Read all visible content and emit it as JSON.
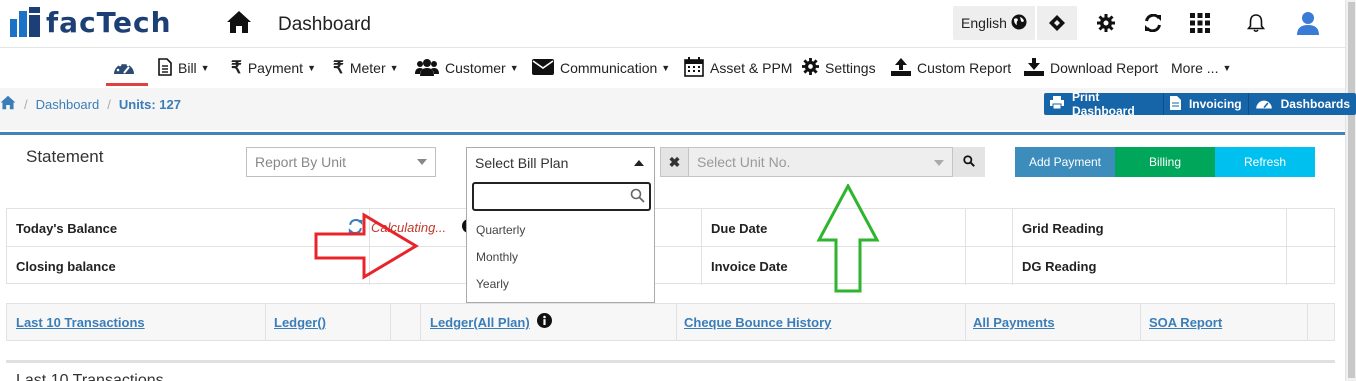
{
  "header": {
    "brand": "facTech",
    "page_title": "Dashboard",
    "language": "English"
  },
  "nav": {
    "items": [
      {
        "label": "Bill"
      },
      {
        "label": "Payment"
      },
      {
        "label": "Meter"
      },
      {
        "label": "Customer"
      },
      {
        "label": "Communication"
      },
      {
        "label": "Asset & PPM"
      },
      {
        "label": "Settings"
      },
      {
        "label": "Custom Report"
      },
      {
        "label": "Download Report"
      },
      {
        "label": "More ..."
      }
    ]
  },
  "breadcrumb": {
    "link": "Dashboard",
    "units": "Units: 127"
  },
  "toolbar": {
    "print": "Print Dashboard",
    "invoicing": "Invoicing",
    "dashboards": "Dashboards"
  },
  "statement": {
    "title": "Statement",
    "report_select": "Report By Unit",
    "bill_plan_select": "Select Bill Plan",
    "bill_plan_options": [
      "Quarterly",
      "Monthly",
      "Yearly"
    ],
    "unit_placeholder": "Select Unit No.",
    "buttons": {
      "add_payment": "Add Payment",
      "billing": "Billing",
      "refresh": "Refresh"
    }
  },
  "balance": {
    "todays_balance": "Today's Balance",
    "calculating": "Calculating...",
    "closing_balance": "Closing balance",
    "due_date": "Due Date",
    "invoice_date": "Invoice Date",
    "grid_reading": "Grid Reading",
    "dg_reading": "DG Reading"
  },
  "links": {
    "last10": "Last 10 Transactions",
    "ledger": "Ledger()",
    "ledger_all": "Ledger(All Plan)",
    "cheque": "Cheque Bounce History",
    "all_payments": "All Payments",
    "soa": "SOA Report"
  },
  "section_title": "Last 10 Transactions",
  "colors": {
    "brand": "#1c3f75",
    "primary": "#3f84bf",
    "billing": "#00a65a",
    "refresh": "#00c0ef",
    "annotation_red": "#e8242b",
    "annotation_green": "#2db52d"
  }
}
